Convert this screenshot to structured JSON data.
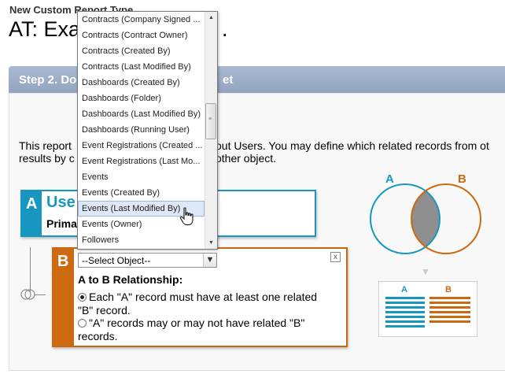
{
  "header": {
    "subtitle": "New Custom Report Type",
    "title_prefix": "AT: Exa",
    "title_suffix": "."
  },
  "step": {
    "title_prefix": "Step 2. Do",
    "title_suffix": "et"
  },
  "description": {
    "line1_prefix": "This report",
    "line1_suffix": "out Users. You may define which related records from ot",
    "line2_prefix": "results by c",
    "line2_suffix": "other object."
  },
  "object_a": {
    "letter": "A",
    "name": "Use",
    "primary_label": "Prima"
  },
  "object_b": {
    "letter": "B",
    "select_value": "--Select Object--",
    "close_label": "x",
    "relationship_heading": "A to B Relationship:",
    "options": [
      {
        "label": "Each \"A\" record must have at least one related",
        "label_line2": "\"B\" record.",
        "selected": true
      },
      {
        "label": "\"A\" records may or may not have related \"B\"",
        "label_line2": "records.",
        "selected": false
      }
    ]
  },
  "dropdown": {
    "items": [
      "Contracts (Company Signed ...",
      "Contracts (Contract Owner)",
      "Contracts (Created By)",
      "Contracts (Last Modified By)",
      "Dashboards (Created By)",
      "Dashboards (Folder)",
      "Dashboards (Last Modified By)",
      "Dashboards (Running User)",
      "Event Registrations (Created ...",
      "Event Registrations (Last Mo...",
      "Events",
      "Events (Created By)",
      "Events (Last Modified By)",
      "Events (Owner)",
      "Followers"
    ],
    "highlighted_index": 12
  },
  "venn": {
    "label_a": "A",
    "label_b": "B",
    "legend_a": "A",
    "legend_b": "B"
  },
  "colors": {
    "a_blue": "#1797c0",
    "b_orange": "#cc6a12",
    "step_bar": "#9fb0c9",
    "overlap": "#8f8f8f"
  }
}
